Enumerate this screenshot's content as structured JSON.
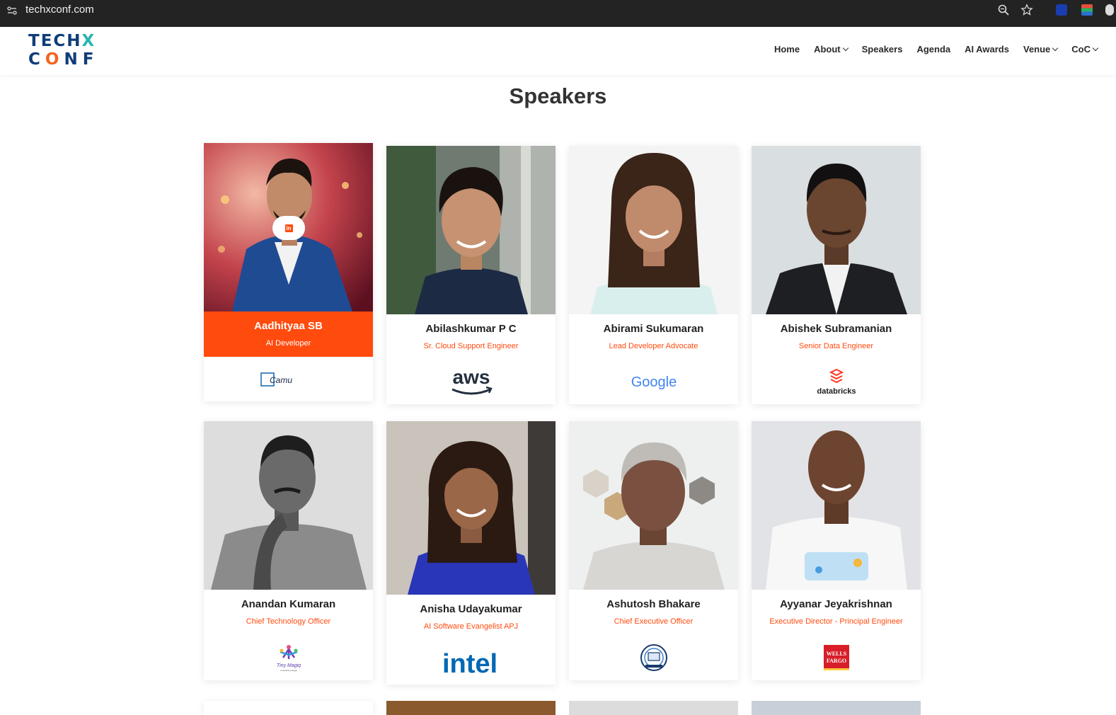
{
  "browser": {
    "url": "techxconf.com"
  },
  "header": {
    "logo_line1": "TECH",
    "logo_x": "X",
    "logo_line2_a": "C",
    "logo_line2_o": "O",
    "logo_line2_b": "NF",
    "nav": {
      "home": "Home",
      "about": "About",
      "speakers": "Speakers",
      "agenda": "Agenda",
      "ai_awards": "AI Awards",
      "venue": "Venue",
      "coc": "CoC"
    }
  },
  "page": {
    "title": "Speakers"
  },
  "speakers": [
    {
      "name": "Aadhityaa SB",
      "role": "AI Developer",
      "company": "Camu"
    },
    {
      "name": "Abilashkumar P C",
      "role": "Sr. Cloud Support Engineer",
      "company": "aws"
    },
    {
      "name": "Abirami Sukumaran",
      "role": "Lead Developer Advocate",
      "company": "Google"
    },
    {
      "name": "Abishek Subramanian",
      "role": "Senior Data Engineer",
      "company": "databricks"
    },
    {
      "name": "Anandan Kumaran",
      "role": "Chief Technology Officer",
      "company": "Tiny Magiq"
    },
    {
      "name": "Anisha Udayakumar",
      "role": "AI Software Evangelist APJ",
      "company": "intel"
    },
    {
      "name": "Ashutosh Bhakare",
      "role": "Chief Executive Officer",
      "company": "logo-badge"
    },
    {
      "name": "Ayyanar Jeyakrishnan",
      "role": "Executive Director - Principal Engineer",
      "company": "WELLS FARGO"
    }
  ],
  "logos": {
    "tinymagiq_sub": "Unleashing Magiq",
    "wf_line1": "WELLS",
    "wf_line2": "FARGO"
  },
  "colors": {
    "accent": "#ff4b0e",
    "logo_navy": "#0f3d78",
    "logo_teal": "#2bb5b0"
  }
}
